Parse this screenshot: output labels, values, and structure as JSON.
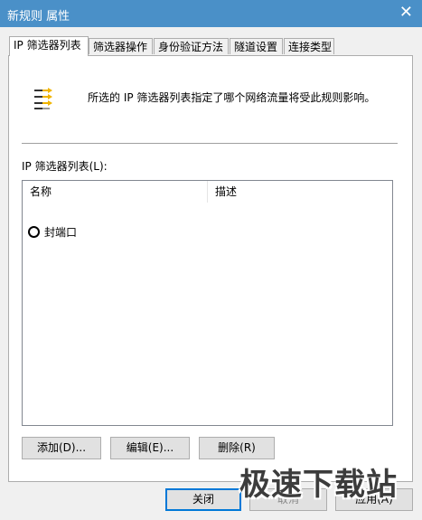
{
  "window": {
    "title": "新规则 属性",
    "close_glyph": "✕"
  },
  "tabs": [
    {
      "label": "IP 筛选器列表",
      "active": true
    },
    {
      "label": "筛选器操作",
      "active": false
    },
    {
      "label": "身份验证方法",
      "active": false
    },
    {
      "label": "隧道设置",
      "active": false
    },
    {
      "label": "连接类型",
      "active": false
    }
  ],
  "panel": {
    "description": "所选的 IP 筛选器列表指定了哪个网络流量将受此规则影响。",
    "list_label": "IP 筛选器列表(L):",
    "columns": [
      "名称",
      "描述"
    ],
    "rows": [
      {
        "name": "封端口",
        "description": "",
        "selected": false
      }
    ]
  },
  "buttons": {
    "add": "添加(D)...",
    "edit": "编辑(E)...",
    "delete": "删除(R)",
    "close": "关闭",
    "cancel": "取消",
    "apply": "应用(A)"
  },
  "watermark": "极速下载站",
  "icons": {
    "filter": "filter-list-icon",
    "close": "close-icon",
    "radio": "radio-icon"
  },
  "colors": {
    "titlebar": "#4a90c8",
    "focus_border": "#0078d7",
    "arrow": "#f0b400"
  }
}
